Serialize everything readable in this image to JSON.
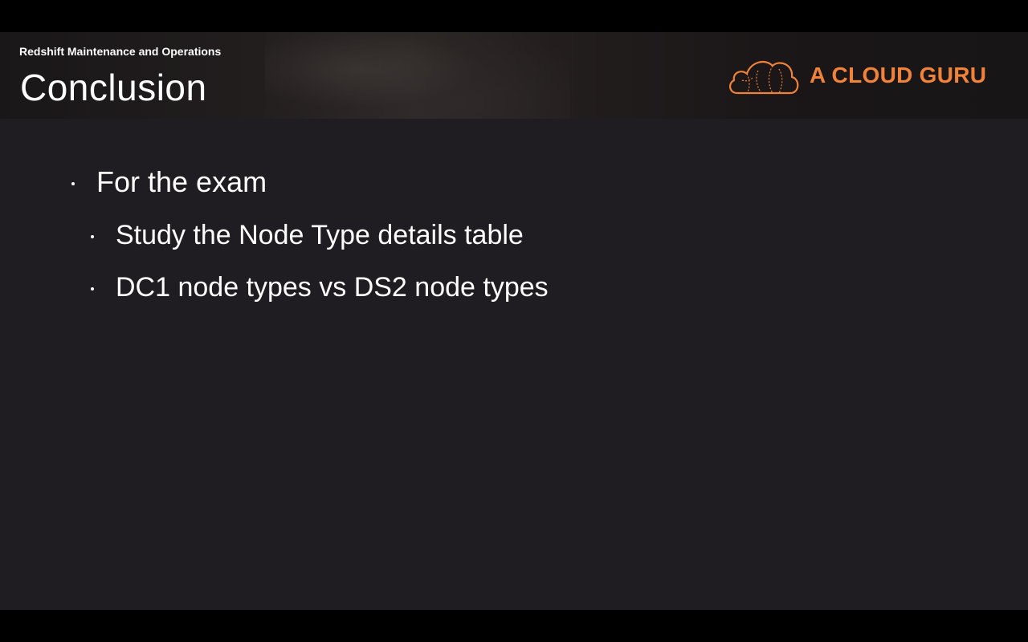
{
  "header": {
    "course_title": "Redshift Maintenance and Operations",
    "slide_title": "Conclusion"
  },
  "logo": {
    "text": "A CLOUD GURU",
    "icon": "cloud-logo-icon",
    "color": "#f0823a"
  },
  "bullets": [
    {
      "level": 1,
      "text": "For the exam"
    },
    {
      "level": 2,
      "text": "Study the Node Type details table"
    },
    {
      "level": 2,
      "text": "DC1 node types vs DS2 node types"
    }
  ],
  "colors": {
    "background": "#1f1d21",
    "letterbox": "#000000",
    "text": "#ffffff",
    "accent": "#f0823a"
  }
}
